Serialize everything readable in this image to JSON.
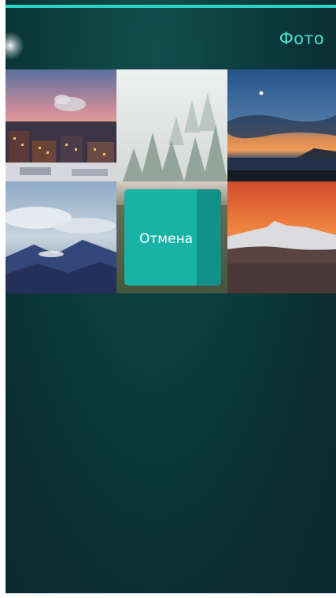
{
  "header": {
    "title": "Фото"
  },
  "gallery": {
    "photos": [
      {
        "name": "snowy-city-sunset"
      },
      {
        "name": "foggy-snowy-forest"
      },
      {
        "name": "lake-sunset-moon"
      },
      {
        "name": "mountain-clouds"
      },
      {
        "name": "forest-valley"
      },
      {
        "name": "snowy-mountain-sunset"
      }
    ]
  },
  "remorse": {
    "cancel_label": "Отмена"
  },
  "colors": {
    "accent": "#2ad3c6",
    "title": "#4ce1d3",
    "background": "#0b3a3c",
    "cancel_button": "#19b3a6"
  }
}
